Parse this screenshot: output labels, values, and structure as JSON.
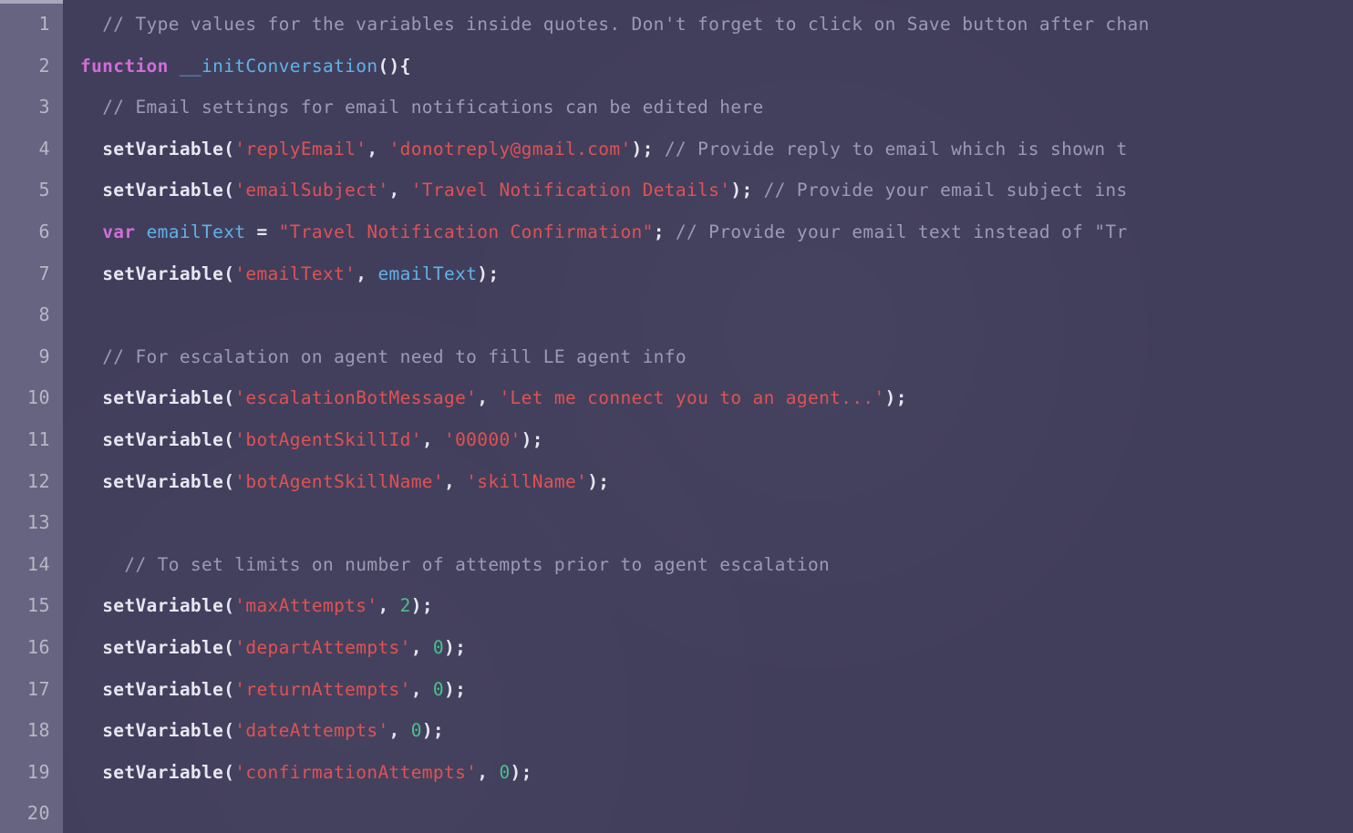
{
  "editor": {
    "language": "javascript",
    "total_lines": 20,
    "first_visible_line": 1,
    "theme": {
      "background": "#413e5c",
      "gutter_background": "#666480",
      "gutter_text": "#b8b6c6",
      "default_text": "#e8e6f0",
      "comment": "#9d9ab4",
      "keyword": "#d16dd8",
      "identifier": "#5fb3e8",
      "string": "#e05252",
      "number": "#46c28a"
    }
  },
  "gutter": {
    "line_numbers": [
      "1",
      "2",
      "3",
      "4",
      "5",
      "6",
      "7",
      "8",
      "9",
      "10",
      "11",
      "12",
      "13",
      "14",
      "15",
      "16",
      "17",
      "18",
      "19",
      "20"
    ]
  },
  "code": {
    "lines": [
      {
        "number": "1",
        "text": "  // Type values for the variables inside quotes. Don't forget to click on Save button after chan",
        "tokens": [
          {
            "t": "  ",
            "c": "plain"
          },
          {
            "t": "// Type values for the variables inside quotes. Don't forget to click on Save button after chan",
            "c": "comment"
          }
        ]
      },
      {
        "number": "2",
        "text": "function __initConversation(){",
        "tokens": [
          {
            "t": "function",
            "c": "keyword"
          },
          {
            "t": " ",
            "c": "plain"
          },
          {
            "t": "__initConversation",
            "c": "ident"
          },
          {
            "t": "(){",
            "c": "punct"
          }
        ]
      },
      {
        "number": "3",
        "text": "  // Email settings for email notifications can be edited here",
        "tokens": [
          {
            "t": "  ",
            "c": "plain"
          },
          {
            "t": "// Email settings for email notifications can be edited here",
            "c": "comment"
          }
        ]
      },
      {
        "number": "4",
        "text": "  setVariable('replyEmail', 'donotreply@gmail.com'); // Provide reply to email which is shown t",
        "tokens": [
          {
            "t": "  ",
            "c": "plain"
          },
          {
            "t": "setVariable",
            "c": "func"
          },
          {
            "t": "(",
            "c": "punct"
          },
          {
            "t": "'replyEmail'",
            "c": "string"
          },
          {
            "t": ", ",
            "c": "punct"
          },
          {
            "t": "'donotreply@gmail.com'",
            "c": "string"
          },
          {
            "t": "); ",
            "c": "punct"
          },
          {
            "t": "// Provide reply to email which is shown t",
            "c": "comment"
          }
        ]
      },
      {
        "number": "5",
        "text": "  setVariable('emailSubject', 'Travel Notification Details'); // Provide your email subject ins",
        "tokens": [
          {
            "t": "  ",
            "c": "plain"
          },
          {
            "t": "setVariable",
            "c": "func"
          },
          {
            "t": "(",
            "c": "punct"
          },
          {
            "t": "'emailSubject'",
            "c": "string"
          },
          {
            "t": ", ",
            "c": "punct"
          },
          {
            "t": "'Travel Notification Details'",
            "c": "string"
          },
          {
            "t": "); ",
            "c": "punct"
          },
          {
            "t": "// Provide your email subject ins",
            "c": "comment"
          }
        ]
      },
      {
        "number": "6",
        "text": "  var emailText = \"Travel Notification Confirmation\"; // Provide your email text instead of \"Tr",
        "tokens": [
          {
            "t": "  ",
            "c": "plain"
          },
          {
            "t": "var",
            "c": "keyword"
          },
          {
            "t": " ",
            "c": "plain"
          },
          {
            "t": "emailText",
            "c": "ident"
          },
          {
            "t": " = ",
            "c": "op"
          },
          {
            "t": "\"Travel Notification Confirmation\"",
            "c": "string"
          },
          {
            "t": "; ",
            "c": "punct"
          },
          {
            "t": "// Provide your email text instead of \"Tr",
            "c": "comment"
          }
        ]
      },
      {
        "number": "7",
        "text": "  setVariable('emailText', emailText);",
        "tokens": [
          {
            "t": "  ",
            "c": "plain"
          },
          {
            "t": "setVariable",
            "c": "func"
          },
          {
            "t": "(",
            "c": "punct"
          },
          {
            "t": "'emailText'",
            "c": "string"
          },
          {
            "t": ", ",
            "c": "punct"
          },
          {
            "t": "emailText",
            "c": "ident"
          },
          {
            "t": ");",
            "c": "punct"
          }
        ]
      },
      {
        "number": "8",
        "text": "",
        "tokens": []
      },
      {
        "number": "9",
        "text": "  // For escalation on agent need to fill LE agent info",
        "tokens": [
          {
            "t": "  ",
            "c": "plain"
          },
          {
            "t": "// For escalation on agent need to fill LE agent info",
            "c": "comment"
          }
        ]
      },
      {
        "number": "10",
        "text": "  setVariable('escalationBotMessage', 'Let me connect you to an agent...');",
        "tokens": [
          {
            "t": "  ",
            "c": "plain"
          },
          {
            "t": "setVariable",
            "c": "func"
          },
          {
            "t": "(",
            "c": "punct"
          },
          {
            "t": "'escalationBotMessage'",
            "c": "string"
          },
          {
            "t": ", ",
            "c": "punct"
          },
          {
            "t": "'Let me connect you to an agent...'",
            "c": "string"
          },
          {
            "t": ");",
            "c": "punct"
          }
        ]
      },
      {
        "number": "11",
        "text": "  setVariable('botAgentSkillId', '00000');",
        "tokens": [
          {
            "t": "  ",
            "c": "plain"
          },
          {
            "t": "setVariable",
            "c": "func"
          },
          {
            "t": "(",
            "c": "punct"
          },
          {
            "t": "'botAgentSkillId'",
            "c": "string"
          },
          {
            "t": ", ",
            "c": "punct"
          },
          {
            "t": "'00000'",
            "c": "string"
          },
          {
            "t": ");",
            "c": "punct"
          }
        ]
      },
      {
        "number": "12",
        "text": "  setVariable('botAgentSkillName', 'skillName');",
        "tokens": [
          {
            "t": "  ",
            "c": "plain"
          },
          {
            "t": "setVariable",
            "c": "func"
          },
          {
            "t": "(",
            "c": "punct"
          },
          {
            "t": "'botAgentSkillName'",
            "c": "string"
          },
          {
            "t": ", ",
            "c": "punct"
          },
          {
            "t": "'skillName'",
            "c": "string"
          },
          {
            "t": ");",
            "c": "punct"
          }
        ]
      },
      {
        "number": "13",
        "text": "",
        "tokens": []
      },
      {
        "number": "14",
        "text": "    // To set limits on number of attempts prior to agent escalation",
        "tokens": [
          {
            "t": "    ",
            "c": "plain"
          },
          {
            "t": "// To set limits on number of attempts prior to agent escalation",
            "c": "comment"
          }
        ]
      },
      {
        "number": "15",
        "text": "  setVariable('maxAttempts', 2);",
        "tokens": [
          {
            "t": "  ",
            "c": "plain"
          },
          {
            "t": "setVariable",
            "c": "func"
          },
          {
            "t": "(",
            "c": "punct"
          },
          {
            "t": "'maxAttempts'",
            "c": "string"
          },
          {
            "t": ", ",
            "c": "punct"
          },
          {
            "t": "2",
            "c": "number"
          },
          {
            "t": ");",
            "c": "punct"
          }
        ]
      },
      {
        "number": "16",
        "text": "  setVariable('departAttempts', 0);",
        "tokens": [
          {
            "t": "  ",
            "c": "plain"
          },
          {
            "t": "setVariable",
            "c": "func"
          },
          {
            "t": "(",
            "c": "punct"
          },
          {
            "t": "'departAttempts'",
            "c": "string"
          },
          {
            "t": ", ",
            "c": "punct"
          },
          {
            "t": "0",
            "c": "number"
          },
          {
            "t": ");",
            "c": "punct"
          }
        ]
      },
      {
        "number": "17",
        "text": "  setVariable('returnAttempts', 0);",
        "tokens": [
          {
            "t": "  ",
            "c": "plain"
          },
          {
            "t": "setVariable",
            "c": "func"
          },
          {
            "t": "(",
            "c": "punct"
          },
          {
            "t": "'returnAttempts'",
            "c": "string"
          },
          {
            "t": ", ",
            "c": "punct"
          },
          {
            "t": "0",
            "c": "number"
          },
          {
            "t": ");",
            "c": "punct"
          }
        ]
      },
      {
        "number": "18",
        "text": "  setVariable('dateAttempts', 0);",
        "tokens": [
          {
            "t": "  ",
            "c": "plain"
          },
          {
            "t": "setVariable",
            "c": "func"
          },
          {
            "t": "(",
            "c": "punct"
          },
          {
            "t": "'dateAttempts'",
            "c": "string"
          },
          {
            "t": ", ",
            "c": "punct"
          },
          {
            "t": "0",
            "c": "number"
          },
          {
            "t": ");",
            "c": "punct"
          }
        ]
      },
      {
        "number": "19",
        "text": "  setVariable('confirmationAttempts', 0);",
        "tokens": [
          {
            "t": "  ",
            "c": "plain"
          },
          {
            "t": "setVariable",
            "c": "func"
          },
          {
            "t": "(",
            "c": "punct"
          },
          {
            "t": "'confirmationAttempts'",
            "c": "string"
          },
          {
            "t": ", ",
            "c": "punct"
          },
          {
            "t": "0",
            "c": "number"
          },
          {
            "t": ");",
            "c": "punct"
          }
        ]
      },
      {
        "number": "20",
        "text": "",
        "tokens": []
      }
    ]
  }
}
